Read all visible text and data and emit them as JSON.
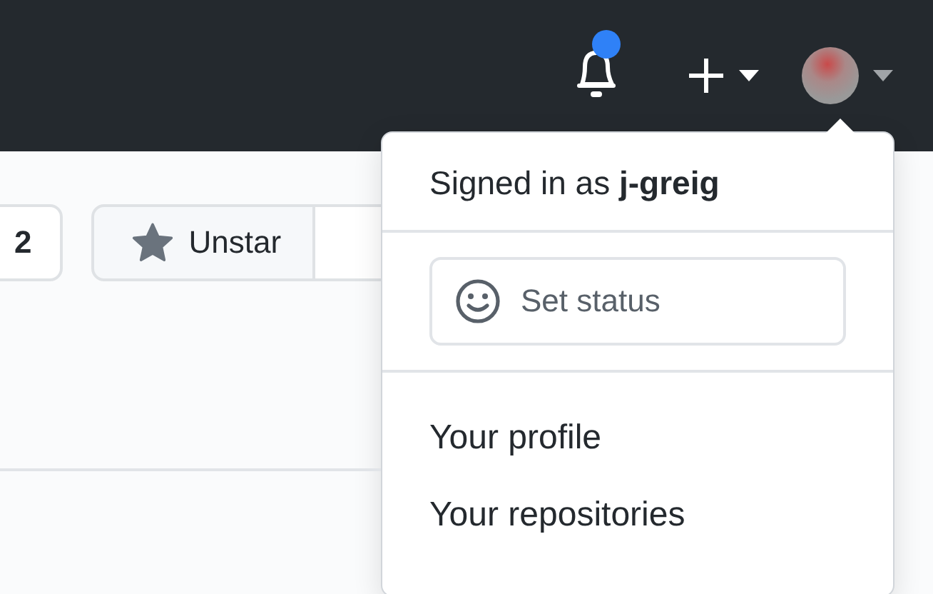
{
  "header": {
    "notifications": {
      "unread": true
    }
  },
  "repo_actions": [
    {
      "kind": "count",
      "label": "2"
    },
    {
      "kind": "star",
      "label": "Unstar"
    }
  ],
  "user_menu": {
    "signed_in_text": "Signed in as **j-greig**",
    "status_button": "Set status",
    "items": [
      "Your profile",
      "Your repositories"
    ]
  }
}
